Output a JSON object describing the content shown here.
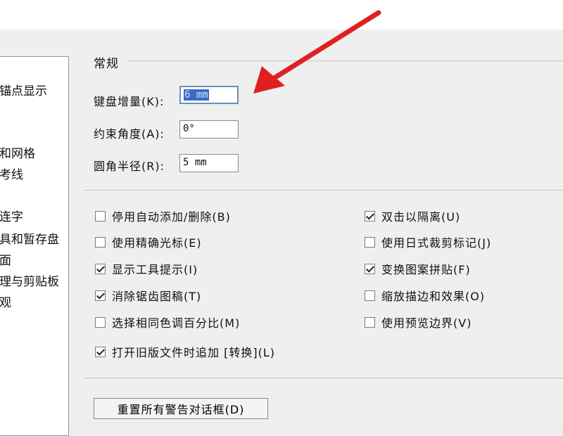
{
  "sidebar": {
    "items": [
      {
        "label": "锚点显示"
      },
      {
        "label": "和网格"
      },
      {
        "label": "考线"
      },
      {
        "label": "连字"
      },
      {
        "label": "具和暂存盘"
      },
      {
        "label": "面"
      },
      {
        "label": "理与剪贴板"
      },
      {
        "label": "观"
      }
    ]
  },
  "general": {
    "title": "常规",
    "keyboard_increment_label": "键盘增量(K):",
    "keyboard_increment_value": "6 mm",
    "constrain_angle_label": "约束角度(A):",
    "constrain_angle_value": "0°",
    "corner_radius_label": "圆角半径(R):",
    "corner_radius_value": "5 mm"
  },
  "options_left": [
    {
      "label": "停用自动添加/删除(B)",
      "checked": false
    },
    {
      "label": "使用精确光标(E)",
      "checked": false
    },
    {
      "label": "显示工具提示(I)",
      "checked": true
    },
    {
      "label": "消除锯齿图稿(T)",
      "checked": true
    },
    {
      "label": "选择相同色调百分比(M)",
      "checked": false
    },
    {
      "label": "打开旧版文件时追加 [转换](L)",
      "checked": true
    }
  ],
  "options_right": [
    {
      "label": "双击以隔离(U)",
      "checked": true
    },
    {
      "label": "使用日式裁剪标记(J)",
      "checked": false
    },
    {
      "label": "变换图案拼贴(F)",
      "checked": true
    },
    {
      "label": "缩放描边和效果(O)",
      "checked": false
    },
    {
      "label": "使用预览边界(V)",
      "checked": false
    }
  ],
  "reset_button_label": "重置所有警告对话框(D)",
  "colors": {
    "arrow": "#e02020",
    "selection": "#3a6bc4"
  }
}
